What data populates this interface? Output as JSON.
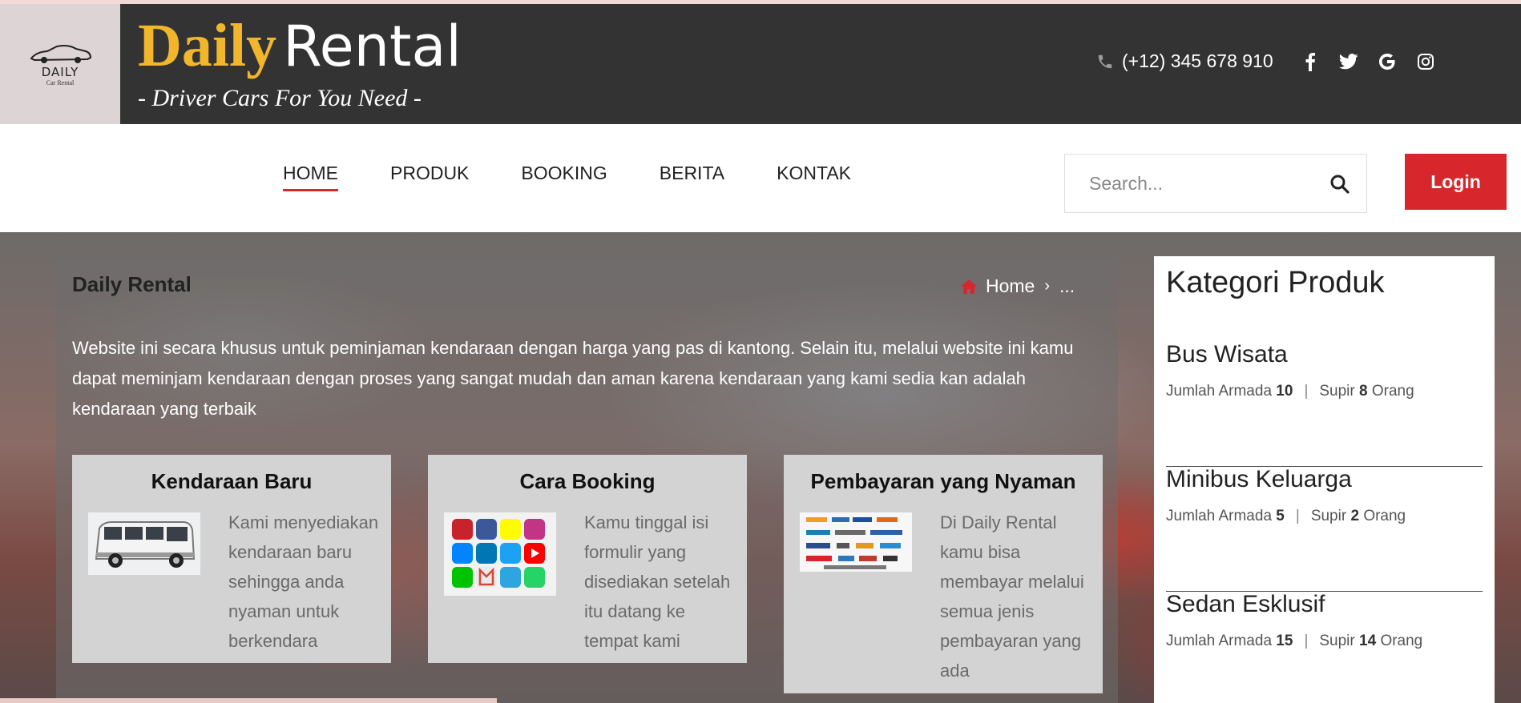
{
  "header": {
    "logo_text": "DAILY",
    "logo_sub": "Car Rental",
    "brand_word1": "Daily",
    "brand_word2": "Rental",
    "tagline": "- Driver Cars For You Need -",
    "phone": "(+12) 345 678 910",
    "social": [
      "facebook-icon",
      "twitter-icon",
      "google-icon",
      "instagram-icon"
    ]
  },
  "nav": {
    "items": [
      "HOME",
      "PRODUK",
      "BOOKING",
      "BERITA",
      "KONTAK"
    ],
    "active": "HOME",
    "search_placeholder": "Search...",
    "login_label": "Login"
  },
  "hero": {
    "title": "Daily Rental",
    "breadcrumb_home": "Home",
    "breadcrumb_current": "...",
    "description": "Website ini secara khusus untuk peminjaman kendaraan dengan harga yang pas di kantong. Selain itu, melalui website ini kamu dapat meminjam kendaraan dengan proses yang sangat mudah dan aman karena kendaraan yang kami sedia kan adalah kendaraan yang terbaik"
  },
  "cards": [
    {
      "title": "Kendaraan Baru",
      "text": "Kami menyediakan kendaraan baru sehingga anda nyaman untuk berkendara"
    },
    {
      "title": "Cara Booking",
      "text": "Kamu tinggal isi formulir yang disediakan setelah itu datang ke tempat kami"
    },
    {
      "title": "Pembayaran yang Nyaman",
      "text": "Di Daily Rental kamu bisa membayar melalui semua jenis pembayaran yang ada"
    }
  ],
  "sidebar": {
    "title": "Kategori Produk",
    "armada_label": "Jumlah Armada",
    "supir_label": "Supir",
    "orang_label": "Orang",
    "categories": [
      {
        "name": "Bus Wisata",
        "armada": "10",
        "supir": "8"
      },
      {
        "name": "Minibus Keluarga",
        "armada": "5",
        "supir": "2"
      },
      {
        "name": "Sedan Esklusif",
        "armada": "15",
        "supir": "14"
      }
    ]
  },
  "colors": {
    "accent": "#d7272c",
    "brand_yellow": "#f1b62b",
    "header_bg": "#333333"
  }
}
